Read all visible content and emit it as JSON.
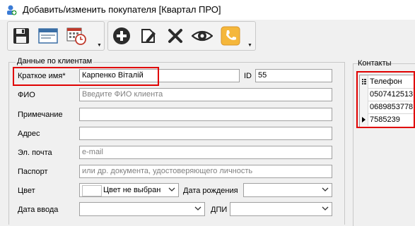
{
  "window": {
    "title": "Добавить/изменить покупателя [Квартал ПРО]"
  },
  "toolbar": {
    "icons": [
      "save-icon",
      "window-icon",
      "calendar-icon",
      "add-icon",
      "edit-icon",
      "delete-icon",
      "view-icon",
      "phone-icon"
    ]
  },
  "client_group": {
    "title": "Данные по клиентам",
    "short_name_label": "Краткое имя*",
    "short_name_value": "Карпенко Віталій",
    "id_label": "ID",
    "id_value": "55",
    "fio_label": "ФИО",
    "fio_placeholder": "Введите ФИО клиента",
    "note_label": "Примечание",
    "address_label": "Адрес",
    "email_label": "Эл. почта",
    "email_placeholder": "e-mail",
    "passport_label": "Паспорт",
    "passport_placeholder": "или др. документа, удостоверяющего личность",
    "color_label": "Цвет",
    "color_value": "Цвет не выбран",
    "birth_label": "Дата рождения",
    "entry_date_label": "Дата ввода",
    "dpi_label": "ДПИ"
  },
  "contacts": {
    "title": "Контакты",
    "column_header": "Телефон",
    "rows": [
      "0507412513",
      "0689853778",
      "7585239"
    ]
  },
  "colors": {
    "highlight": "#e00000"
  }
}
